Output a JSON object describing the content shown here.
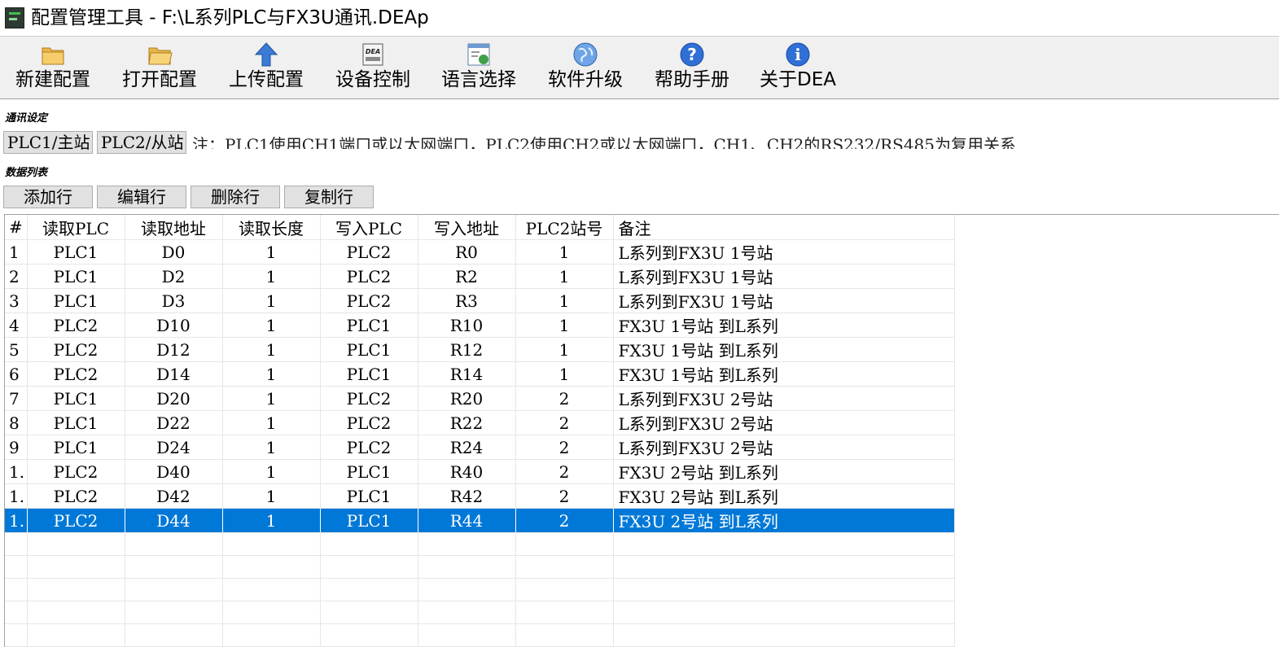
{
  "window": {
    "title": "配置管理工具 - F:\\L系列PLC与FX3U通讯.DEAp"
  },
  "toolbar": {
    "items": [
      {
        "label": "新建配置",
        "icon": "new-folder-icon"
      },
      {
        "label": "打开配置",
        "icon": "open-folder-icon"
      },
      {
        "label": "上传配置",
        "icon": "upload-arrow-icon"
      },
      {
        "label": "设备控制",
        "icon": "device-icon"
      },
      {
        "label": "语言选择",
        "icon": "language-icon"
      },
      {
        "label": "软件升级",
        "icon": "globe-icon"
      },
      {
        "label": "帮助手册",
        "icon": "help-icon"
      },
      {
        "label": "关于DEA",
        "icon": "info-icon"
      }
    ]
  },
  "comm": {
    "section_label": "通讯设定",
    "plc1_button": "PLC1/主站",
    "plc2_button": "PLC2/从站",
    "note": "注：PLC1使用CH1端口或以太网端口，PLC2使用CH2或以太网端口，CH1、CH2的RS232/RS485为复用关系"
  },
  "datalist": {
    "section_label": "数据列表",
    "buttons": {
      "add": "添加行",
      "edit": "编辑行",
      "delete": "删除行",
      "copy": "复制行"
    }
  },
  "table": {
    "columns": [
      "#",
      "读取PLC",
      "读取地址",
      "读取长度",
      "写入PLC",
      "写入地址",
      "PLC2站号",
      "备注"
    ],
    "selected_row": 11,
    "rows": [
      [
        "1",
        "PLC1",
        "D0",
        "1",
        "PLC2",
        "R0",
        "1",
        "L系列到FX3U  1号站"
      ],
      [
        "2",
        "PLC1",
        "D2",
        "1",
        "PLC2",
        "R2",
        "1",
        "L系列到FX3U  1号站"
      ],
      [
        "3",
        "PLC1",
        "D3",
        "1",
        "PLC2",
        "R3",
        "1",
        "L系列到FX3U  1号站"
      ],
      [
        "4",
        "PLC2",
        "D10",
        "1",
        "PLC1",
        "R10",
        "1",
        "FX3U  1号站 到L系列"
      ],
      [
        "5",
        "PLC2",
        "D12",
        "1",
        "PLC1",
        "R12",
        "1",
        "FX3U  1号站 到L系列"
      ],
      [
        "6",
        "PLC2",
        "D14",
        "1",
        "PLC1",
        "R14",
        "1",
        "FX3U  1号站 到L系列"
      ],
      [
        "7",
        "PLC1",
        "D20",
        "1",
        "PLC2",
        "R20",
        "2",
        "L系列到FX3U  2号站"
      ],
      [
        "8",
        "PLC1",
        "D22",
        "1",
        "PLC2",
        "R22",
        "2",
        "L系列到FX3U  2号站"
      ],
      [
        "9",
        "PLC1",
        "D24",
        "1",
        "PLC2",
        "R24",
        "2",
        "L系列到FX3U  2号站"
      ],
      [
        "1.",
        "PLC2",
        "D40",
        "1",
        "PLC1",
        "R40",
        "2",
        "FX3U  2号站 到L系列"
      ],
      [
        "1.",
        "PLC2",
        "D42",
        "1",
        "PLC1",
        "R42",
        "2",
        "FX3U  2号站 到L系列"
      ],
      [
        "1.",
        "PLC2",
        "D44",
        "1",
        "PLC1",
        "R44",
        "2",
        "FX3U  2号站 到L系列"
      ]
    ],
    "empty_rows": 6
  },
  "colors": {
    "selection": "#0078d7",
    "toolbar_bg": "#f0f0f0",
    "button_bg": "#e1e1e1"
  }
}
